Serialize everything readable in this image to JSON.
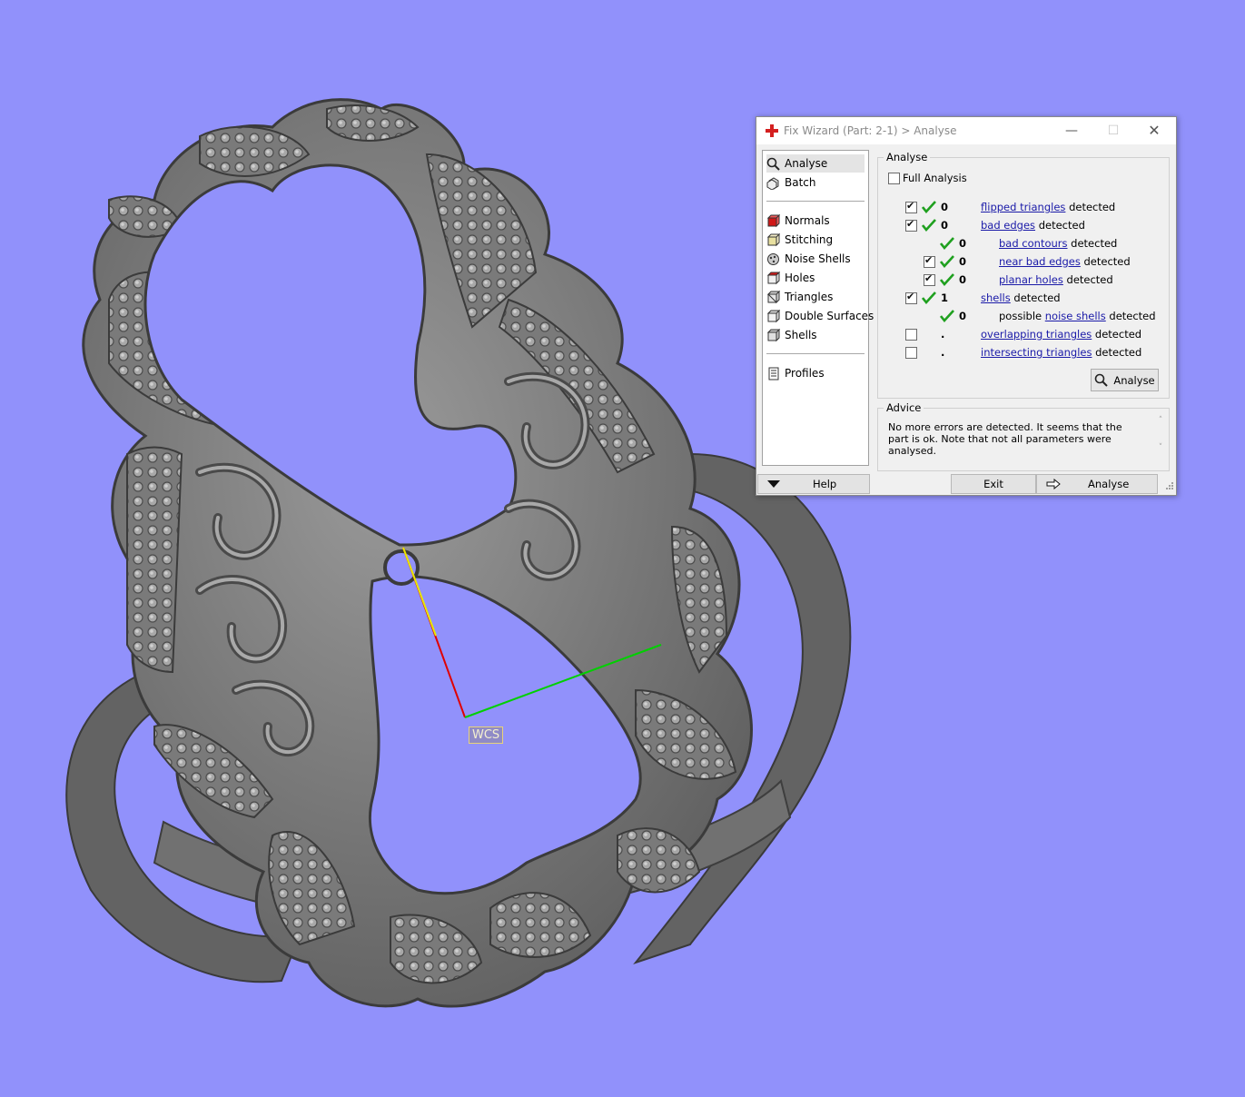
{
  "viewport": {
    "background": "#9191fb",
    "wcs_label": "WCS"
  },
  "dialog": {
    "title": "Fix Wizard (Part: 2-1) > Analyse",
    "icon": "red-cross-icon",
    "window_buttons": {
      "minimize": "—",
      "maximize": "☐",
      "close": "✕"
    },
    "sidebar": {
      "groups": [
        [
          {
            "label": "Analyse",
            "icon": "magnifier-icon",
            "selected": true
          },
          {
            "label": "Batch",
            "icon": "batch-icon",
            "selected": false
          }
        ],
        [
          {
            "label": "Normals",
            "icon": "normals-cube-icon",
            "selected": false
          },
          {
            "label": "Stitching",
            "icon": "stitching-cube-icon",
            "selected": false
          },
          {
            "label": "Noise Shells",
            "icon": "noise-shells-icon",
            "selected": false
          },
          {
            "label": "Holes",
            "icon": "holes-cube-icon",
            "selected": false
          },
          {
            "label": "Triangles",
            "icon": "triangles-cube-icon",
            "selected": false
          },
          {
            "label": "Double Surfaces",
            "icon": "double-surfaces-cube-icon",
            "selected": false
          },
          {
            "label": "Shells",
            "icon": "shells-cube-icon",
            "selected": false
          }
        ],
        [
          {
            "label": "Profiles",
            "icon": "profiles-icon",
            "selected": false
          }
        ]
      ]
    },
    "analyse": {
      "group_label": "Analyse",
      "full_analysis_label": "Full Analysis",
      "full_analysis_checked": false,
      "suffix": "detected",
      "rows": [
        {
          "checkbox": true,
          "checked": true,
          "tick": true,
          "count": "0",
          "prefix": "",
          "link": "flipped triangles",
          "level": 0
        },
        {
          "checkbox": true,
          "checked": true,
          "tick": true,
          "count": "0",
          "prefix": "",
          "link": "bad edges",
          "level": 0
        },
        {
          "checkbox": false,
          "checked": false,
          "tick": true,
          "count": "0",
          "prefix": "",
          "link": "bad contours",
          "level": 1
        },
        {
          "checkbox": true,
          "checked": true,
          "tick": true,
          "count": "0",
          "prefix": "",
          "link": "near bad edges",
          "level": 1
        },
        {
          "checkbox": true,
          "checked": true,
          "tick": true,
          "count": "0",
          "prefix": "",
          "link": "planar holes",
          "level": 1
        },
        {
          "checkbox": true,
          "checked": true,
          "tick": true,
          "count": "1",
          "prefix": "",
          "link": "shells",
          "level": 0
        },
        {
          "checkbox": false,
          "checked": false,
          "tick": true,
          "count": "0",
          "prefix": "possible ",
          "link": "noise shells",
          "level": 1
        },
        {
          "checkbox": true,
          "checked": false,
          "tick": false,
          "count": ".",
          "prefix": "",
          "link": "overlapping triangles",
          "level": 0
        },
        {
          "checkbox": true,
          "checked": false,
          "tick": false,
          "count": ".",
          "prefix": "",
          "link": "intersecting triangles",
          "level": 0
        }
      ],
      "button_label": "Analyse"
    },
    "advice": {
      "group_label": "Advice",
      "text": "No more errors are detected. It seems that the part is ok. Note that not all parameters were analysed."
    },
    "bottom": {
      "help_label": "Help",
      "exit_label": "Exit",
      "analyse_label": "Analyse"
    },
    "colors": {
      "tick_green": "#1fa01f",
      "link_blue": "#1a1aa8",
      "title_grey": "#8a8a8a"
    }
  }
}
